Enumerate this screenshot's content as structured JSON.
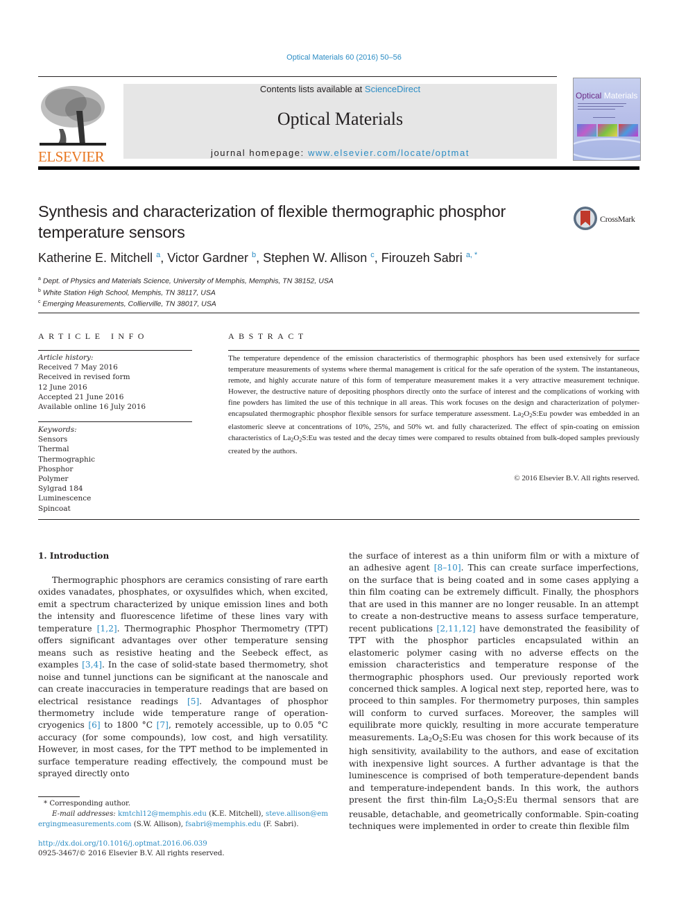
{
  "header": {
    "journal_ref": "Optical Materials 60 (2016) 50–56",
    "contents_prefix": "Contents lists available at ",
    "contents_link": "ScienceDirect",
    "journal_title": "Optical Materials",
    "homepage_prefix": "journal homepage: ",
    "homepage_link": "www.elsevier.com/locate/optmat",
    "publisher_logo": "ELSEVIER",
    "cover_title_1": "Optical",
    "cover_title_2": "Materials",
    "colors": {
      "link": "#2b8cc4",
      "elsevier_orange": "#e87722",
      "masthead_bg": "#e6e6e6"
    }
  },
  "article": {
    "title": "Synthesis and characterization of flexible thermographic phosphor temperature sensors",
    "crossmark_label": "CrossMark",
    "authors": [
      {
        "name": "Katherine E. Mitchell",
        "aff": "a",
        "sep": ", "
      },
      {
        "name": "Victor Gardner",
        "aff": "b",
        "sep": ", "
      },
      {
        "name": "Stephen W. Allison",
        "aff": "c",
        "sep": ", "
      },
      {
        "name": "Firouzeh Sabri",
        "aff": "a, *",
        "sep": ""
      }
    ],
    "affiliations": [
      {
        "mark": "a",
        "text": "Dept. of Physics and Materials Science, University of Memphis, Memphis, TN 38152, USA"
      },
      {
        "mark": "b",
        "text": "White Station High School, Memphis, TN 38117, USA"
      },
      {
        "mark": "c",
        "text": "Emerging Measurements, Collierville, TN 38017, USA"
      }
    ]
  },
  "article_info": {
    "label": "ARTICLE INFO",
    "history_label": "Article history:",
    "history": [
      "Received 7 May 2016",
      "Received in revised form",
      "12 June 2016",
      "Accepted 21 June 2016",
      "Available online 16 July 2016"
    ],
    "keywords_label": "Keywords:",
    "keywords": [
      "Sensors",
      "Thermal",
      "Thermographic",
      "Phosphor",
      "Polymer",
      "Sylgrad 184",
      "Luminescence",
      "Spincoat"
    ]
  },
  "abstract": {
    "label": "ABSTRACT",
    "p1": "The temperature dependence of the emission characteristics of thermographic phosphors has been used extensively for surface temperature measurements of systems where thermal management is critical for the safe operation of the system. The instantaneous, remote, and highly accurate nature of this form of temperature measurement makes it a very attractive measurement technique. However, the destructive nature of depositing phosphors directly onto the surface of interest and the complications of working with fine powders has limited the use of this technique in all areas. This work focuses on the design and characterization of polymer-encapsulated thermographic phosphor flexible sensors for surface temperature assessment. ",
    "formula_la": "La",
    "formula_o": "O",
    "formula_s": "S:Eu",
    "p2": " powder was embedded in an elastomeric sleeve at concentrations of 10%, 25%, and 50% wt. and fully characterized. The effect of spin-coating on emission characteristics of ",
    "p3": " was tested and the decay times were compared to results obtained from bulk-doped samples previously created by the authors.",
    "copyright": "© 2016 Elsevier B.V. All rights reserved."
  },
  "intro": {
    "heading": "1.  Introduction",
    "c1_a": "Thermographic phosphors are ceramics consisting of rare earth oxides vanadates, phosphates, or oxysulfides which, when excited, emit a spectrum characterized by unique emission lines and both the intensity and fluorescence lifetime of these lines vary with temperature ",
    "ref_1": "[1,2]",
    "c1_b": ". Thermographic Phosphor Thermometry (TPT) offers significant advantages over other temperature sensing means such as resistive heating and the Seebeck effect, as examples ",
    "ref_2": "[3,4]",
    "c1_c": ". In the case of solid-state based thermometry, shot noise and tunnel junctions can be significant at the nanoscale and can create inaccuracies in temperature readings that are based on electrical resistance readings ",
    "ref_3": "[5]",
    "c1_d": ". Advantages of phosphor thermometry include wide temperature range of operation-cryogenics ",
    "ref_4": "[6]",
    "c1_e": " to 1800 °C ",
    "ref_5": "[7]",
    "c1_f": ", remotely accessible, up to 0.05 °C accuracy (for some compounds), low cost, and high versatility. However, in most cases, for the TPT method to be implemented in surface temperature reading effectively, the compound must be sprayed directly onto",
    "c2_a": "the surface of interest as a thin uniform film or with a mixture of an adhesive agent ",
    "ref_6": "[8–10]",
    "c2_b": ". This can create surface imperfections, on the surface that is being coated and in some cases applying a thin film coating can be extremely difficult. Finally, the phosphors that are used in this manner are no longer reusable. In an attempt to create a non-destructive means to assess surface temperature, recent publications ",
    "ref_7": "[2,11,12]",
    "c2_c": " have demonstrated the feasibility of TPT with the phosphor particles encapsulated within an elastomeric polymer casing with no adverse effects on the emission characteristics and temperature response of the thermographic phosphors used. Our previously reported work concerned thick samples. A logical next step, reported here, was to proceed to thin samples. For thermometry purposes, thin samples will conform to curved surfaces. Moreover, the samples will equilibrate more quickly, resulting in more accurate temperature measurements. ",
    "c2_d": " was chosen for this work because of its high sensitivity, availability to the authors, and ease of excitation with inexpensive light sources. A further advantage is that the luminescence is comprised of both temperature-dependent bands and temperature-independent bands. In this work, the authors present the first thin-film ",
    "c2_e": " thermal sensors that are reusable, detachable, and geometrically conformable. Spin-coating techniques were implemented in order to create thin flexible film"
  },
  "footnotes": {
    "corresponding": "* Corresponding author.",
    "email_label": "E-mail addresses:",
    "email_1": "kmtchl12@memphis.edu",
    "email_1_who": " (K.E. Mitchell), ",
    "email_2": "steve.allison@emergingmeasurements.com",
    "email_2_who": " (S.W. Allison), ",
    "email_3": "fsabri@memphis.edu",
    "email_3_who": " (F. Sabri).",
    "doi": "http://dx.doi.org/10.1016/j.optmat.2016.06.039",
    "issn": "0925-3467/© 2016 Elsevier B.V. All rights reserved."
  }
}
